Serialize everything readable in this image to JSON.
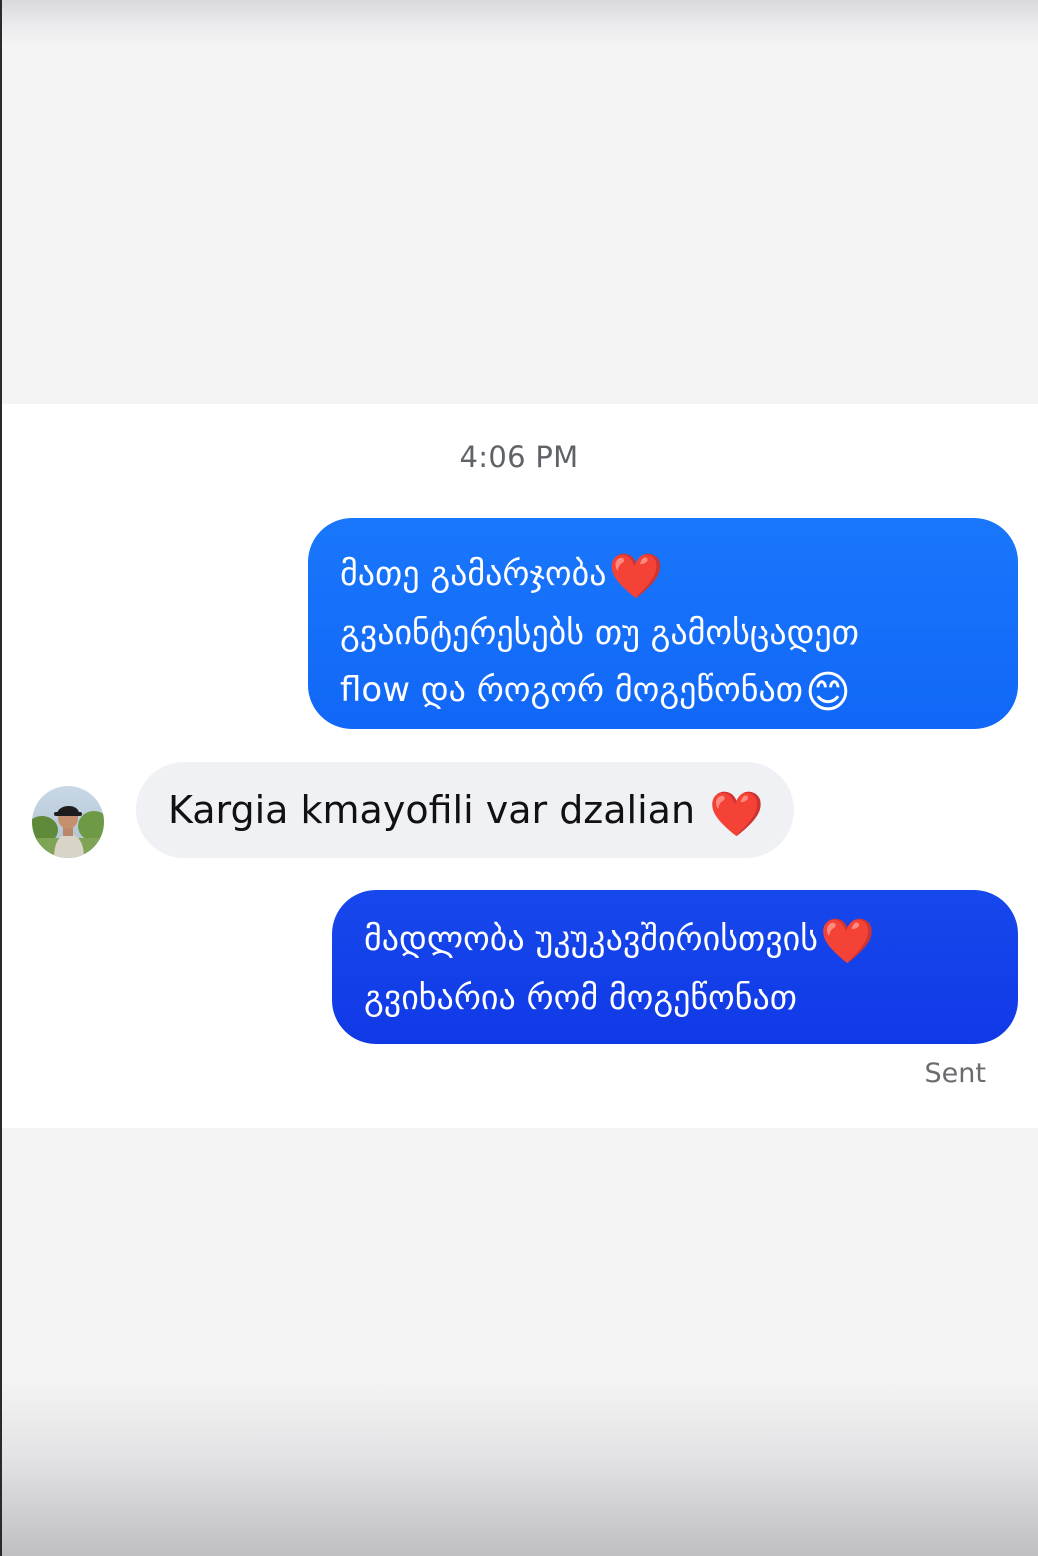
{
  "conversation": {
    "timestamp": "4:06 PM",
    "messages": [
      {
        "direction": "outgoing",
        "lines": [
          "მათე გამარჯობა",
          "გვაინტერესებს თუ გამოსცადეთ",
          "flow და როგორ მოგეწონათ"
        ],
        "emojis": {
          "line1": "❤️",
          "line3": "😊"
        }
      },
      {
        "direction": "incoming",
        "text": "Kargia kmayofili var dzalian",
        "emoji": "❤️",
        "avatar": "user-photo-avatar"
      },
      {
        "direction": "outgoing",
        "lines": [
          "მადლობა უკუკავშირისთვის",
          "გვიხარია რომ მოგეწონათ"
        ],
        "emojis": {
          "line1": "❤️"
        }
      }
    ],
    "status": "Sent"
  },
  "colors": {
    "outgoing_bubble_1": "#1a72fa",
    "outgoing_bubble_2": "#1341e9",
    "incoming_bubble": "#f0f1f4",
    "background": "#ffffff"
  }
}
